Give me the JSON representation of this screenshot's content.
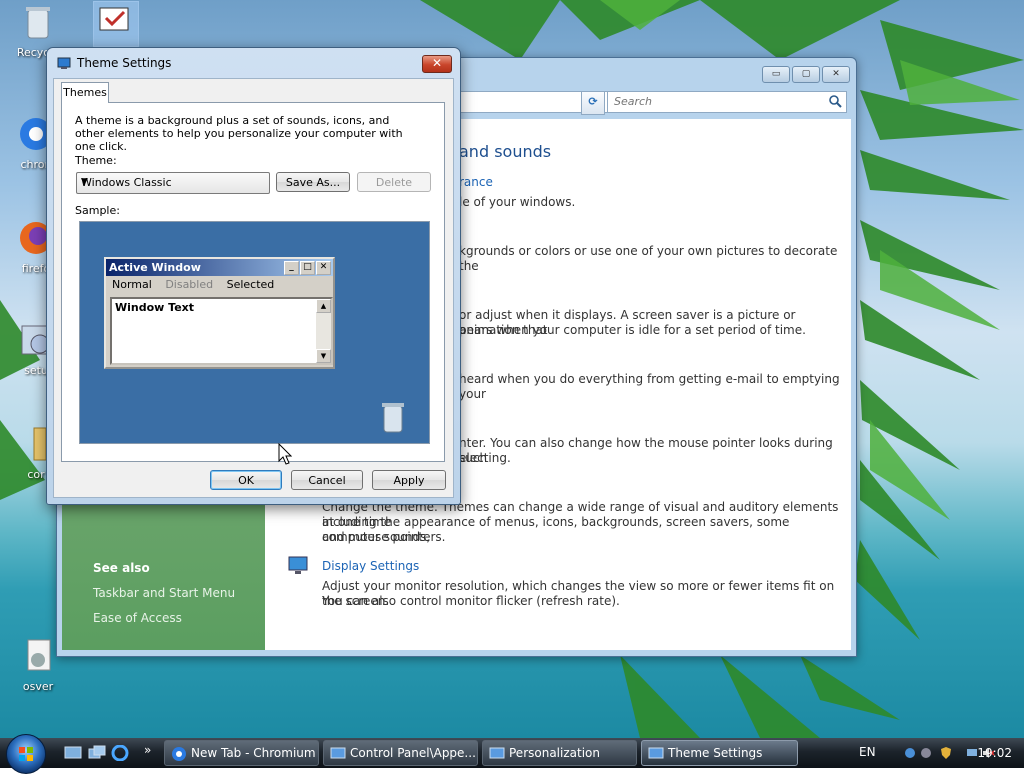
{
  "desktop": {
    "icons": [
      {
        "label": "Recycle"
      },
      {
        "label": "chron"
      },
      {
        "label": "firefo"
      },
      {
        "label": "setu"
      },
      {
        "label": "cor"
      },
      {
        "label": "osver"
      }
    ]
  },
  "control_panel": {
    "search_placeholder": "Search",
    "page_title": "and sounds",
    "items": [
      {
        "link": "rance",
        "desc": "le of your windows."
      },
      {
        "desc": "kgrounds or colors or use one of your own pictures to decorate the"
      },
      {
        "desc1": "or adjust when it displays. A screen saver is a picture or animation that",
        "desc2": "pears when your computer is idle for a set period of time."
      },
      {
        "desc": "heard when you do everything from getting e-mail to emptying your"
      },
      {
        "desc1": "nter. You can also change how the mouse pointer looks during such",
        "desc2": "electing."
      },
      {
        "desc1": "Change the theme. Themes can change a wide range of visual and auditory elements at one time",
        "desc2": "including the appearance of menus, icons, backgrounds, screen savers, some computer sounds,",
        "desc3": "and mouse pointers."
      },
      {
        "link": "Display Settings",
        "desc1": "Adjust your monitor resolution, which changes the view so more or fewer items fit on the screen.",
        "desc2": "You can also control monitor flicker (refresh rate)."
      }
    ],
    "see_also": {
      "title": "See also",
      "links": [
        "Taskbar and Start Menu",
        "Ease of Access"
      ]
    },
    "window_buttons": {
      "minimize": "▭",
      "maximize": "▢",
      "close": "✕"
    }
  },
  "dialog": {
    "title": "Theme Settings",
    "close_glyph": "✕",
    "tab": "Themes",
    "description": "A theme is a background plus a set of sounds, icons, and other elements to help you personalize your computer with one click.",
    "theme_label": "Theme:",
    "theme_value": "Windows Classic",
    "save_as": "Save As...",
    "delete": "Delete",
    "sample_label": "Sample:",
    "sample": {
      "active_window": "Active Window",
      "menu": {
        "normal": "Normal",
        "disabled": "Disabled",
        "selected": "Selected"
      },
      "window_text": "Window Text"
    },
    "ok": "OK",
    "cancel": "Cancel",
    "apply": "Apply"
  },
  "taskbar": {
    "tasks": [
      {
        "label": "New Tab - Chromium",
        "active": false
      },
      {
        "label": "Control Panel\\Appe...",
        "active": false
      },
      {
        "label": "Personalization",
        "active": false
      },
      {
        "label": "Theme Settings",
        "active": true
      }
    ],
    "chevron": "»",
    "language": "EN",
    "clock": "19:02"
  },
  "colors": {
    "sample_desktop": "#3a6ea5",
    "active_caption": "#0a246a",
    "see_also_panel": "#5b9e60",
    "link_blue": "#1c64b5"
  }
}
